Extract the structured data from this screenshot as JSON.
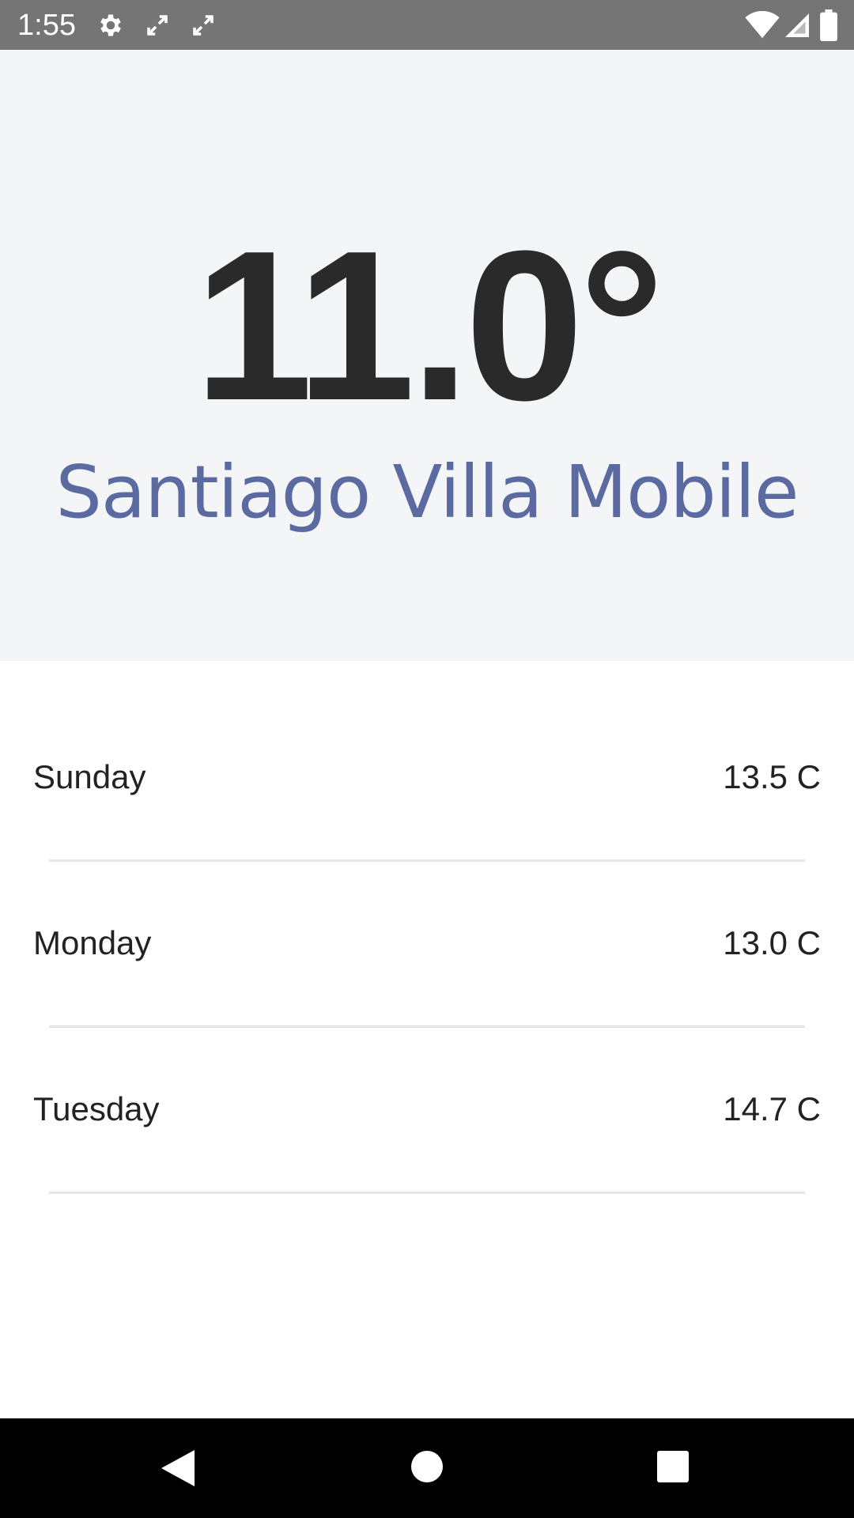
{
  "status_bar": {
    "time": "1:55",
    "background_color": "#757575",
    "icons": [
      "gear-icon",
      "expand-icon",
      "expand-icon",
      "wifi-icon",
      "signal-icon",
      "battery-icon"
    ]
  },
  "weather": {
    "temperature": "11.0°",
    "location": "Santiago Villa Mobile",
    "header_background": "#f4f5f7",
    "location_color": "#5b6ba1"
  },
  "forecast": [
    {
      "day": "Sunday",
      "temp": "13.5 C"
    },
    {
      "day": "Monday",
      "temp": "13.0 C"
    },
    {
      "day": "Tuesday",
      "temp": "14.7 C"
    }
  ],
  "nav_bar": {
    "buttons": [
      "back-icon",
      "home-icon",
      "recents-icon"
    ]
  }
}
